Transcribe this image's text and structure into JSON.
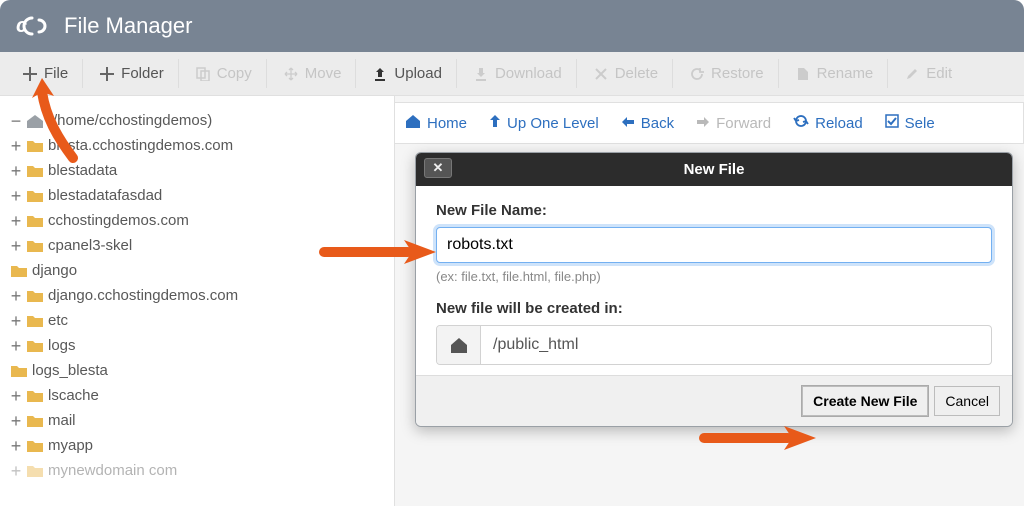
{
  "header": {
    "title": "File Manager"
  },
  "toolbar": {
    "file": "File",
    "folder": "Folder",
    "copy": "Copy",
    "move": "Move",
    "upload": "Upload",
    "download": "Download",
    "delete": "Delete",
    "restore": "Restore",
    "rename": "Rename",
    "edit": "Edit"
  },
  "nav": {
    "home": "Home",
    "up": "Up One Level",
    "back": "Back",
    "forward": "Forward",
    "reload": "Reload",
    "select_all": "Sele"
  },
  "tree": {
    "root": "(/home/cchostingdemos)",
    "items": [
      "blesta.cchostingdemos.com",
      "blestadata",
      "blestadatafasdad",
      "cchostingdemos.com",
      "cpanel3-skel",
      "django",
      "django.cchostingdemos.com",
      "etc",
      "logs",
      "logs_blesta",
      "lscache",
      "mail",
      "myapp",
      "mynewdomain com"
    ]
  },
  "dialog": {
    "title": "New File",
    "filename_label": "New File Name:",
    "filename_value": "robots.txt",
    "hint": "(ex: file.txt, file.html, file.php)",
    "path_label": "New file will be created in:",
    "path_value": "/public_html",
    "create": "Create New File",
    "cancel": "Cancel"
  }
}
